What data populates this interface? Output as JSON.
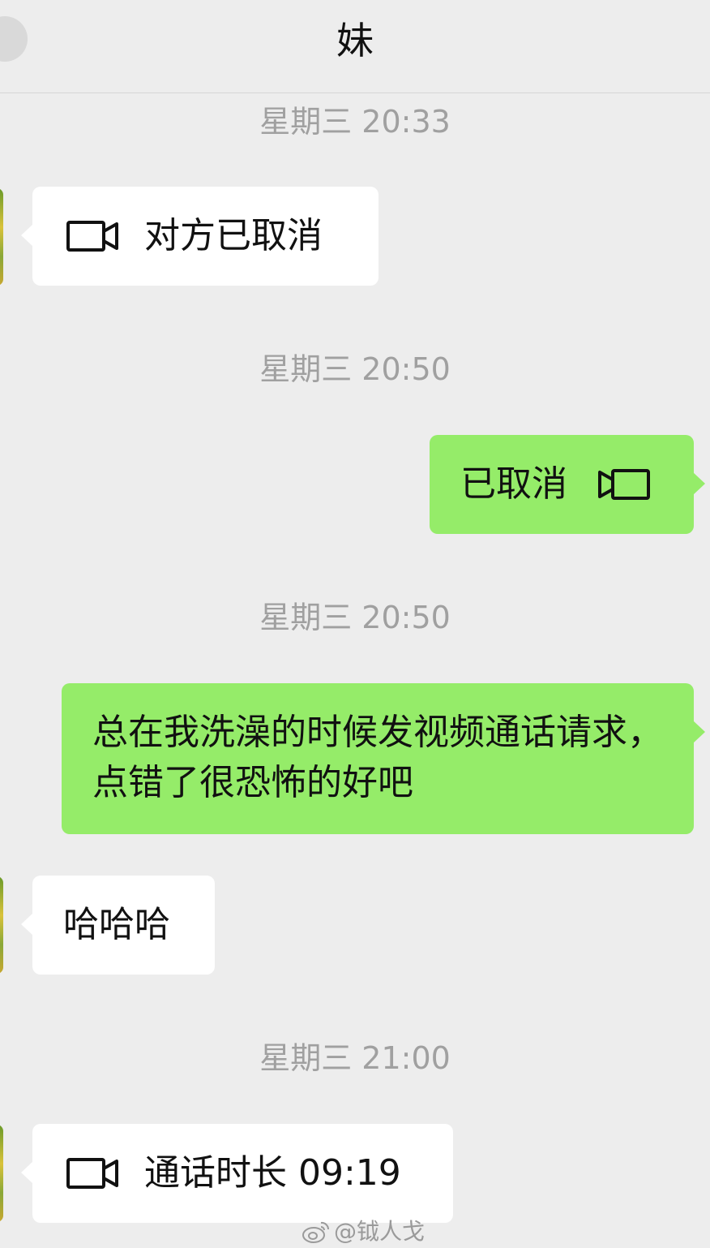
{
  "header": {
    "title": "妹"
  },
  "timestamps": [
    "星期三 20:33",
    "星期三 20:50",
    "星期三 20:50",
    "星期三 21:00"
  ],
  "messages": [
    {
      "direction": "incoming",
      "type": "video-call",
      "text": "对方已取消",
      "icon": "video-camera-icon"
    },
    {
      "direction": "outgoing",
      "type": "video-call",
      "text": "已取消",
      "icon": "video-camera-icon"
    },
    {
      "direction": "outgoing",
      "type": "text",
      "text": "总在我洗澡的时候发视频通话请求，点错了很恐怖的好吧"
    },
    {
      "direction": "incoming",
      "type": "text",
      "text": "哈哈哈"
    },
    {
      "direction": "incoming",
      "type": "video-call",
      "text": "通话时长 09:19",
      "icon": "video-camera-icon"
    }
  ],
  "watermark": {
    "text": "@钺人戈",
    "icon": "weibo-icon"
  },
  "colors": {
    "background": "#ededed",
    "incoming_bubble": "#ffffff",
    "outgoing_bubble": "#95ec69",
    "timestamp": "#a0a0a0"
  }
}
